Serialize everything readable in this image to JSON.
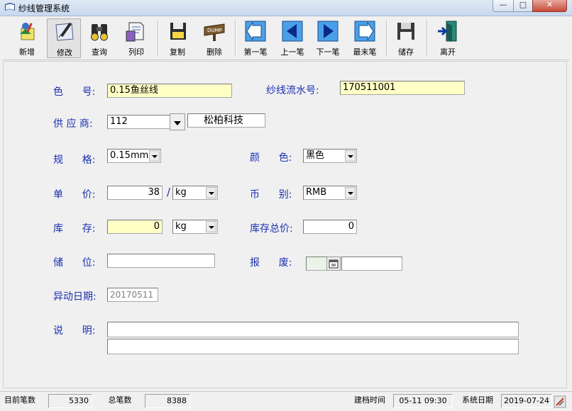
{
  "window": {
    "title": "纱线管理系统",
    "min_label": "—",
    "max_label": "□",
    "close_label": "✕"
  },
  "toolbar": {
    "buttons": [
      {
        "label": "新增",
        "icon": "new-note-icon"
      },
      {
        "label": "修改",
        "icon": "edit-pen-icon"
      },
      {
        "label": "查询",
        "icon": "binoculars-icon"
      },
      {
        "label": "列印",
        "icon": "print-icon"
      },
      {
        "label": "复制",
        "icon": "floppy-copy-icon"
      },
      {
        "label": "删除",
        "icon": "dump-sign-icon"
      },
      {
        "label": "第一笔",
        "icon": "first-arrow-icon"
      },
      {
        "label": "上一笔",
        "icon": "prev-arrow-icon"
      },
      {
        "label": "下一笔",
        "icon": "next-arrow-icon"
      },
      {
        "label": "最末笔",
        "icon": "last-arrow-icon"
      },
      {
        "label": "储存",
        "icon": "save-disk-icon"
      },
      {
        "label": "离开",
        "icon": "exit-door-icon"
      }
    ]
  },
  "form": {
    "color_no_label": "色      号:",
    "color_no_value": "0.15鱼丝线",
    "serial_label": "纱线流水号:",
    "serial_value": "170511001",
    "supplier_label": "供 应 商:",
    "supplier_code": "112",
    "supplier_name": "松柏科技",
    "spec_label": "规      格:",
    "spec_value": "0.15mm",
    "color_label": "颜      色:",
    "color_value": "黑色",
    "price_label": "单      价:",
    "price_value": "38",
    "price_slash": "/",
    "price_unit": "kg",
    "currency_label": "币      别:",
    "currency_value": "RMB",
    "stock_label": "库      存:",
    "stock_value": "0",
    "stock_unit": "kg",
    "stock_total_label": "库存总价:",
    "stock_total_value": "0",
    "location_label": "储      位:",
    "location_value": "",
    "scrap_label": "报      废:",
    "scrap_value": "",
    "change_date_label": "异动日期:",
    "change_date_value": "20170511",
    "remark_label": "说      明:",
    "remark_line1": "",
    "remark_line2": ""
  },
  "status": {
    "current_label": "目前笔数",
    "current_value": "5330",
    "total_label": "总笔数",
    "total_value": "8388",
    "created_label": "建档时间",
    "created_value": "05-11 09:30",
    "sysdate_label": "系统日期",
    "sysdate_value": "2019-07-24"
  },
  "colors": {
    "label_blue": "#1a2fb0",
    "field_yellow": "#ffffc6"
  }
}
